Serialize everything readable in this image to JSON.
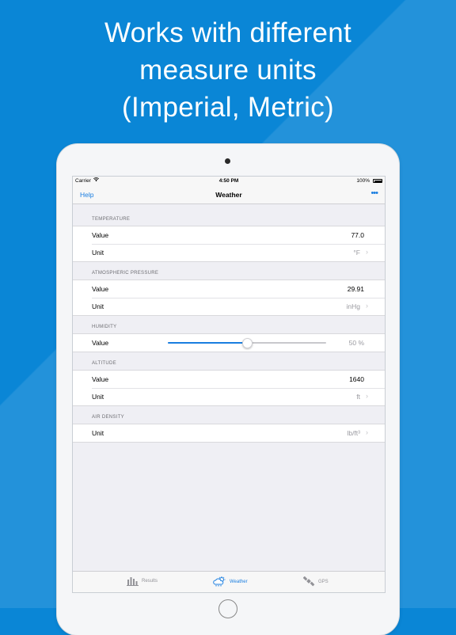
{
  "headline": {
    "line1": "Works with different",
    "line2": "measure units",
    "line3": "(Imperial, Metric)"
  },
  "statusbar": {
    "carrier": "Carrier",
    "time": "4:50 PM",
    "battery": "100%"
  },
  "navbar": {
    "left": "Help",
    "title": "Weather",
    "right": "•••"
  },
  "sections": {
    "temperature": {
      "header": "TEMPERATURE",
      "value_label": "Value",
      "value": "77.0",
      "unit_label": "Unit",
      "unit": "°F"
    },
    "pressure": {
      "header": "ATMOSPHERIC PRESSURE",
      "value_label": "Value",
      "value": "29.91",
      "unit_label": "Unit",
      "unit": "inHg"
    },
    "humidity": {
      "header": "HUMIDITY",
      "value_label": "Value",
      "value": "50 %",
      "level": 0.5
    },
    "altitude": {
      "header": "ALTITUDE",
      "value_label": "Value",
      "value": "1640",
      "unit_label": "Unit",
      "unit": "ft"
    },
    "air_density": {
      "header": "AIR DENSITY",
      "unit_label": "Unit",
      "unit": "lb/ft³"
    }
  },
  "tabs": [
    {
      "label": "Results",
      "icon": "bar-chart-icon",
      "active": false
    },
    {
      "label": "Weather",
      "icon": "weather-cloud-icon",
      "active": true
    },
    {
      "label": "GPS",
      "icon": "satellite-icon",
      "active": false
    }
  ],
  "colors": {
    "background": "#0a86d6",
    "accent": "#1a7ee0"
  }
}
